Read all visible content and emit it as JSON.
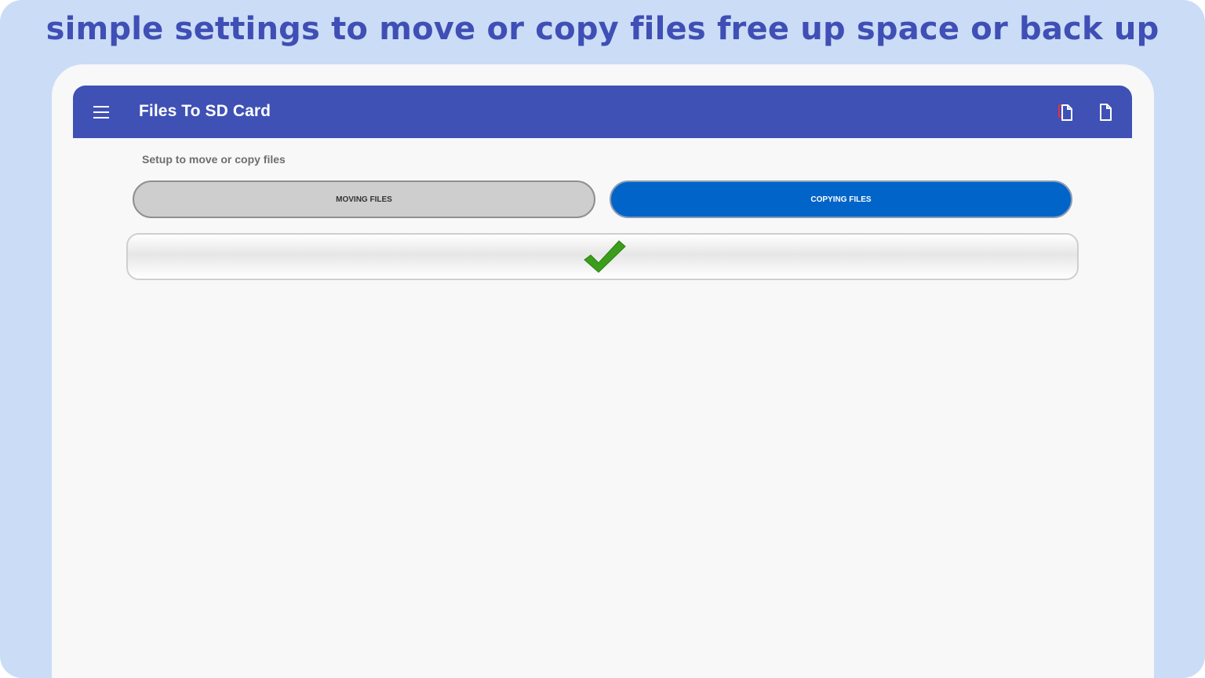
{
  "banner": {
    "headline": "simple settings to move or copy files free up space or back up"
  },
  "appbar": {
    "title": "Files To SD Card",
    "menu_icon": "hamburger-menu-icon",
    "action_icons": [
      "copy-files-icon",
      "file-icon"
    ],
    "color": "#3f51b5"
  },
  "setup": {
    "label": "Setup to move or copy files",
    "options": [
      {
        "label": "MOVING FILES",
        "selected": false
      },
      {
        "label": "COPYING FILES",
        "selected": true
      }
    ],
    "selected_color": "#0064c8",
    "unselected_color": "#cecece"
  },
  "status": {
    "icon": "checkmark-icon",
    "color": "#3a9e1a"
  }
}
